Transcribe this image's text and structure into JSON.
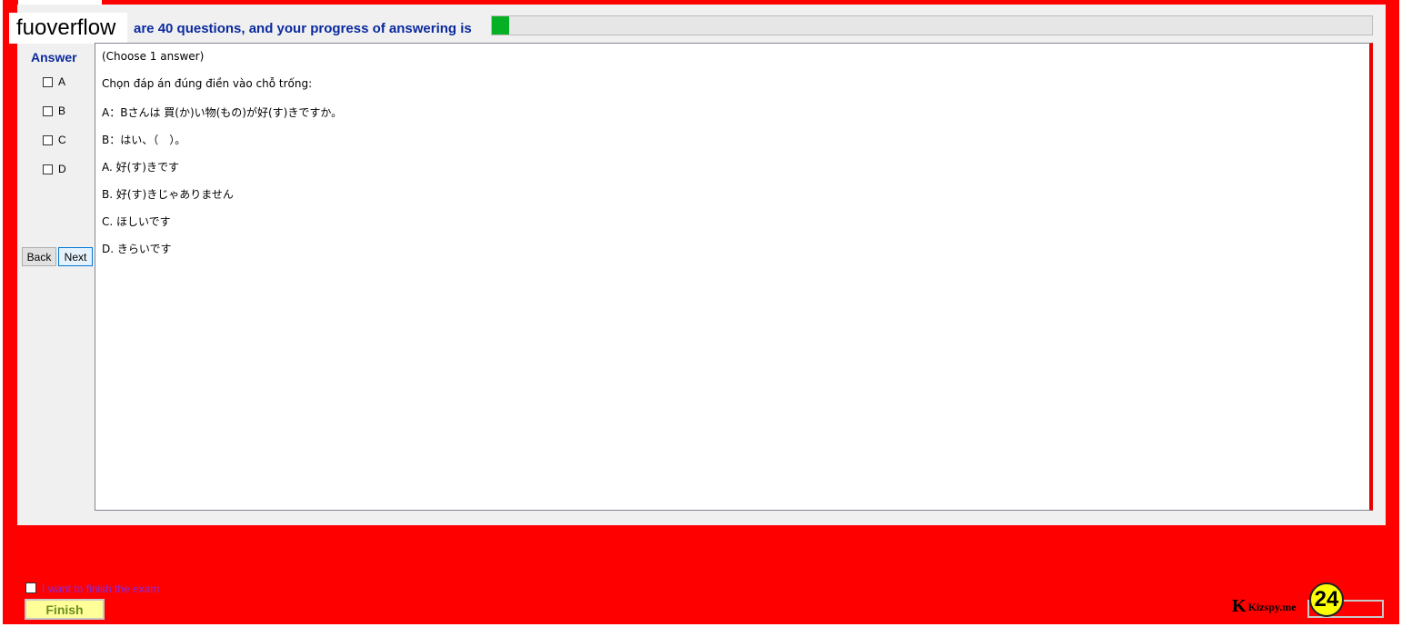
{
  "brand": "fuoverflow",
  "progress": {
    "text": "are 40 questions, and your progress of answering is",
    "fraction": 0.02,
    "fill_color": "#06b025"
  },
  "answer_panel": {
    "title": "Answer",
    "options": [
      "A",
      "B",
      "C",
      "D"
    ]
  },
  "nav": {
    "back_label": "Back",
    "next_label": "Next"
  },
  "question": {
    "lines": [
      "(Choose 1 answer)",
      "Chọn đáp án đúng điền vào chỗ trống:",
      "A：Bさんは 買(か)い物(もの)が好(す)きですか。",
      "B：はい、（　）。",
      "A.  好(す)きです",
      "B.  好(す)きじゃありません",
      "C.  ほしいです",
      "D.  きらいです"
    ]
  },
  "footer": {
    "finish_checkbox_label": "I want to finish the exam",
    "finish_button_label": "Finish",
    "watermark": {
      "letter": "K",
      "text": "Kizspy.me"
    },
    "badge": "24"
  },
  "colors": {
    "frame": "#ff0000",
    "accent_text": "#0b2a9e",
    "finish_button_bg": "#ffff99"
  }
}
